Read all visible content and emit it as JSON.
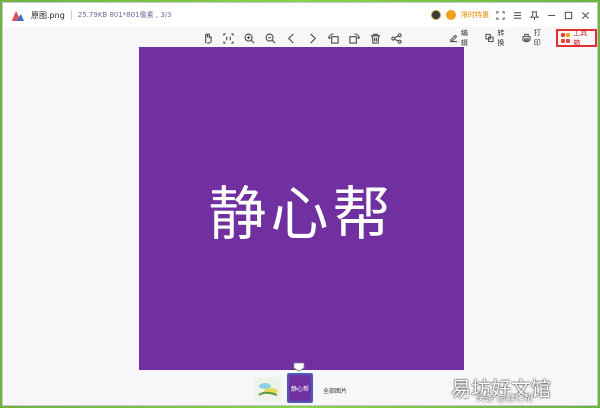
{
  "titlebar": {
    "file_name": "原图.png",
    "meta": "25.79KB  801*801像素 , 3/3",
    "vip_label": "限时特惠"
  },
  "toolbar": {
    "tools": [
      {
        "name": "fit-window",
        "icon": "hand-icon"
      },
      {
        "name": "actual-size",
        "icon": "one-to-one-icon"
      },
      {
        "name": "zoom-in",
        "icon": "zoom-in-icon"
      },
      {
        "name": "zoom-out",
        "icon": "zoom-out-icon"
      },
      {
        "name": "previous",
        "icon": "chevron-left-icon"
      },
      {
        "name": "next",
        "icon": "chevron-right-icon"
      },
      {
        "name": "rotate-left",
        "icon": "rotate-left-icon"
      },
      {
        "name": "rotate-right",
        "icon": "rotate-right-icon"
      },
      {
        "name": "delete",
        "icon": "trash-icon"
      },
      {
        "name": "share",
        "icon": "share-icon"
      }
    ],
    "edit_label": "编辑",
    "convert_label": "转换",
    "print_label": "打印",
    "toolbox_label": "工具箱"
  },
  "canvas": {
    "text": "静心帮",
    "background": "#7030a0"
  },
  "filmstrip": {
    "thumb_2_label": "静心帮",
    "all_images_label": "全部图片"
  },
  "watermark": {
    "main": "易坊好文馆",
    "sub": "头条 @静心帮"
  }
}
